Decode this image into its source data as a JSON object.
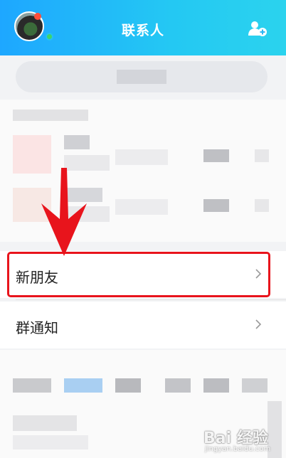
{
  "header": {
    "title": "联系人",
    "avatar_icon": "user-avatar",
    "add_icon": "add-contact-icon"
  },
  "search": {
    "placeholder": ""
  },
  "menu": {
    "new_friends_label": "新朋友",
    "group_notice_label": "群通知"
  },
  "annotation": {
    "highlight_color": "#e8141c",
    "arrow_color": "#e8141c"
  },
  "watermark": {
    "brand": "Bai 经验",
    "url": "jingyan.baidu.com"
  },
  "colors": {
    "header_start": "#1ea7ff",
    "header_end": "#2bd3ee"
  }
}
